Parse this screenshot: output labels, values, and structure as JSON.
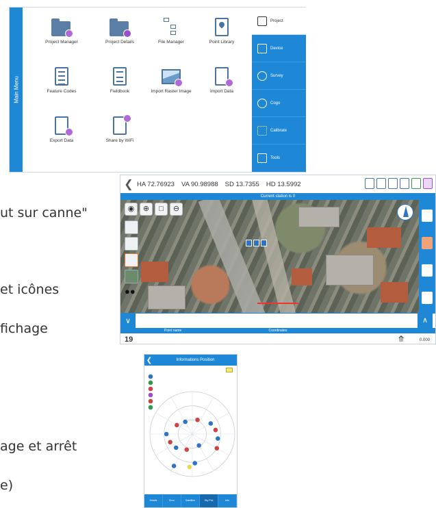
{
  "main_menu": {
    "title": "Main Menu",
    "tiles": [
      {
        "label": "Project Manager",
        "icon": "folder-icon"
      },
      {
        "label": "Project Details",
        "icon": "folder-info-icon"
      },
      {
        "label": "File Manager",
        "icon": "file-tree-icon"
      },
      {
        "label": "Point Library",
        "icon": "point-library-icon"
      },
      {
        "label": "Feature Codes",
        "icon": "feature-codes-icon"
      },
      {
        "label": "Fieldbook",
        "icon": "fieldbook-icon"
      },
      {
        "label": "Import Raster Image",
        "icon": "raster-image-icon"
      },
      {
        "label": "Import Data",
        "icon": "import-data-icon"
      },
      {
        "label": "Export Data",
        "icon": "export-data-icon"
      },
      {
        "label": "Share by WiFi",
        "icon": "wifi-share-icon"
      }
    ],
    "right_items": [
      {
        "label": "Project",
        "active": true
      },
      {
        "label": "Device",
        "active": false
      },
      {
        "label": "Survey",
        "active": false
      },
      {
        "label": "Cogo",
        "active": false
      },
      {
        "label": "Calibrate",
        "active": false
      },
      {
        "label": "Tools",
        "active": false
      }
    ]
  },
  "background_text": [
    "ut sur canne\"",
    "et icônes",
    "fichage",
    "age et arrêt",
    "e)"
  ],
  "survey": {
    "ha": "HA 72.76923",
    "va": "VA 90.98988",
    "sd": "SD 13.7355",
    "hd": "HD 13.5992",
    "station": "Current station is 0",
    "table_headers": [
      "Point name",
      "Coordinates",
      ""
    ],
    "point_number": "19",
    "height": "0.000",
    "colors": {
      "accent": "#1e88d6",
      "points": "#2f73c9",
      "line": "#e33333"
    }
  },
  "sky": {
    "title": "Informations Position",
    "tabs": [
      "Details",
      "Error",
      "Satellites",
      "Sky Plot",
      "Info"
    ],
    "active_tab": 3,
    "satellites": [
      {
        "az": 150,
        "el": 62,
        "color": "#2f73c9"
      },
      {
        "az": 200,
        "el": 55,
        "color": "#c44"
      },
      {
        "az": 230,
        "el": 45,
        "color": "#2f73c9"
      },
      {
        "az": 250,
        "el": 40,
        "color": "#c44"
      },
      {
        "az": 270,
        "el": 35,
        "color": "#2f73c9"
      },
      {
        "az": 300,
        "el": 52,
        "color": "#c44"
      },
      {
        "az": 330,
        "el": 60,
        "color": "#2f73c9"
      },
      {
        "az": 20,
        "el": 58,
        "color": "#c44"
      },
      {
        "az": 60,
        "el": 45,
        "color": "#2f73c9"
      },
      {
        "az": 80,
        "el": 40,
        "color": "#c44"
      },
      {
        "az": 100,
        "el": 35,
        "color": "#2f73c9"
      },
      {
        "az": 120,
        "el": 30,
        "color": "#c44"
      },
      {
        "az": 210,
        "el": 12,
        "color": "#2f73c9"
      },
      {
        "az": 175,
        "el": 28,
        "color": "#2f73c9"
      },
      {
        "az": 185,
        "el": 20,
        "color": "#e8d94a"
      }
    ],
    "legend_colors": [
      "#2f73c9",
      "#2e9d4b",
      "#c44",
      "#9a4fcc",
      "#c44",
      "#2e9d4b"
    ]
  }
}
